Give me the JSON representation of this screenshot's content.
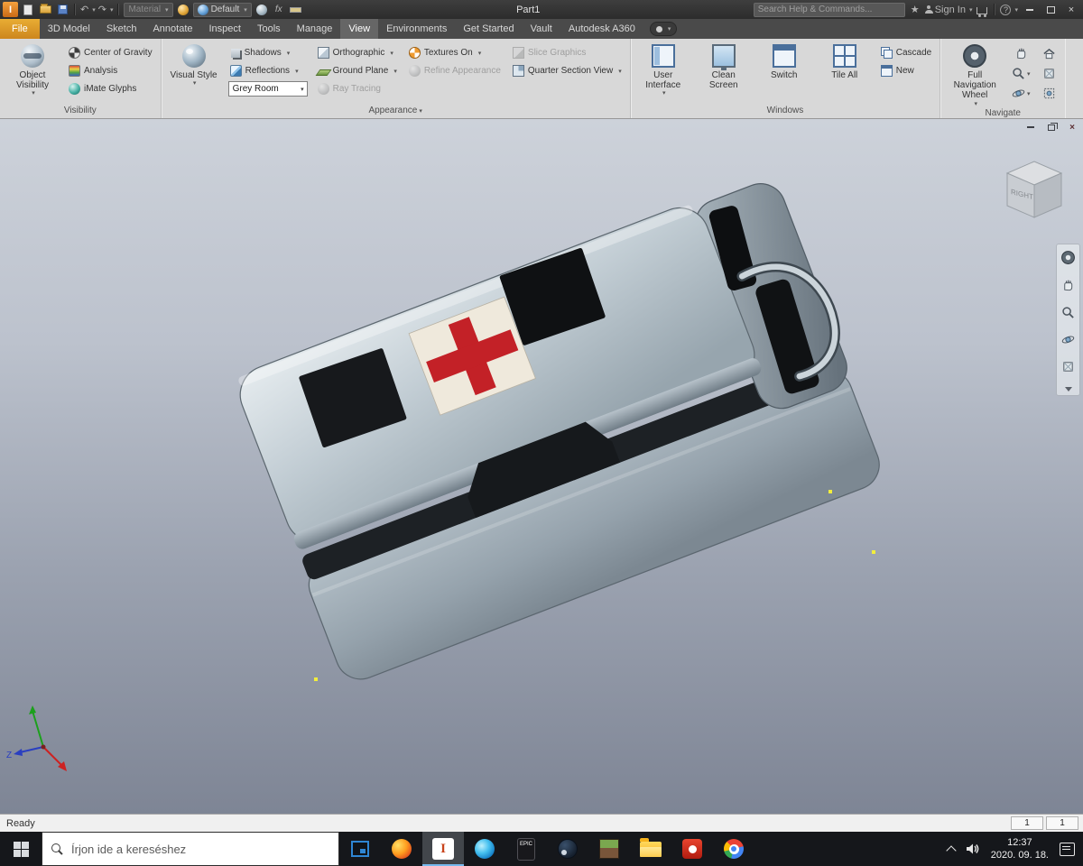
{
  "colors": {
    "file_tab": "#d8951f",
    "titlebar_bg": "#323232",
    "ribbon_bg": "#d8d8d8",
    "viewport_gradient_top": "#cdd2da",
    "viewport_gradient_bottom": "#7e8595",
    "cross_red": "#c32127",
    "model_metal": "#bcc8d0",
    "taskbar_bg": "#15171b",
    "active_task_underline": "#76b9ed",
    "sketch_point_yellow": "#f2ee3c"
  },
  "icons": {
    "logo_letter": "I",
    "undo": "↶",
    "redo": "↷",
    "star": "★",
    "help": "?",
    "fx": "fx",
    "close": "×",
    "mdi_close": "×"
  },
  "titlebar": {
    "document_title": "Part1",
    "material_value": "Material",
    "appearance_value": "Default",
    "search_placeholder": "Search Help & Commands...",
    "sign_in_label": "Sign In"
  },
  "tabs": {
    "items": [
      "File",
      "3D Model",
      "Sketch",
      "Annotate",
      "Inspect",
      "Tools",
      "Manage",
      "View",
      "Environments",
      "Get Started",
      "Vault",
      "Autodesk A360"
    ],
    "active": "View"
  },
  "ribbon": {
    "visibility": {
      "label": "Visibility",
      "object_visibility": "Object Visibility",
      "center_of_gravity": "Center of Gravity",
      "analysis": "Analysis",
      "imate_glyphs": "iMate Glyphs"
    },
    "appearance": {
      "label": "Appearance",
      "visual_style": "Visual Style",
      "shadows": "Shadows",
      "reflections": "Reflections",
      "room_style": "Grey Room",
      "orthographic": "Orthographic",
      "ground_plane": "Ground Plane",
      "ray_tracing": "Ray Tracing",
      "textures_on": "Textures On",
      "refine_appearance": "Refine Appearance",
      "slice_graphics": "Slice Graphics",
      "quarter_section_view": "Quarter Section View"
    },
    "windows": {
      "label": "Windows",
      "user_interface": "User Interface",
      "clean_screen": "Clean Screen",
      "switch": "Switch",
      "tile_all": "Tile All",
      "cascade": "Cascade",
      "new": "New"
    },
    "navigate": {
      "label": "Navigate",
      "full_navigation_wheel": "Full Navigation Wheel"
    }
  },
  "viewport": {
    "viewcube_face": "RIGHT",
    "triad_z": "Z"
  },
  "statusbar": {
    "ready": "Ready",
    "counter1": "1",
    "counter2": "1"
  },
  "taskbar": {
    "search_placeholder": "Írjon ide a kereséshez",
    "epic_label": "EPIC",
    "time": "12:37",
    "date": "2020. 09. 18.",
    "icon_names": [
      "task-view",
      "firefox",
      "inventor",
      "edge",
      "epic-games",
      "steam",
      "minecraft",
      "file-explorer",
      "red-app",
      "chrome"
    ]
  }
}
